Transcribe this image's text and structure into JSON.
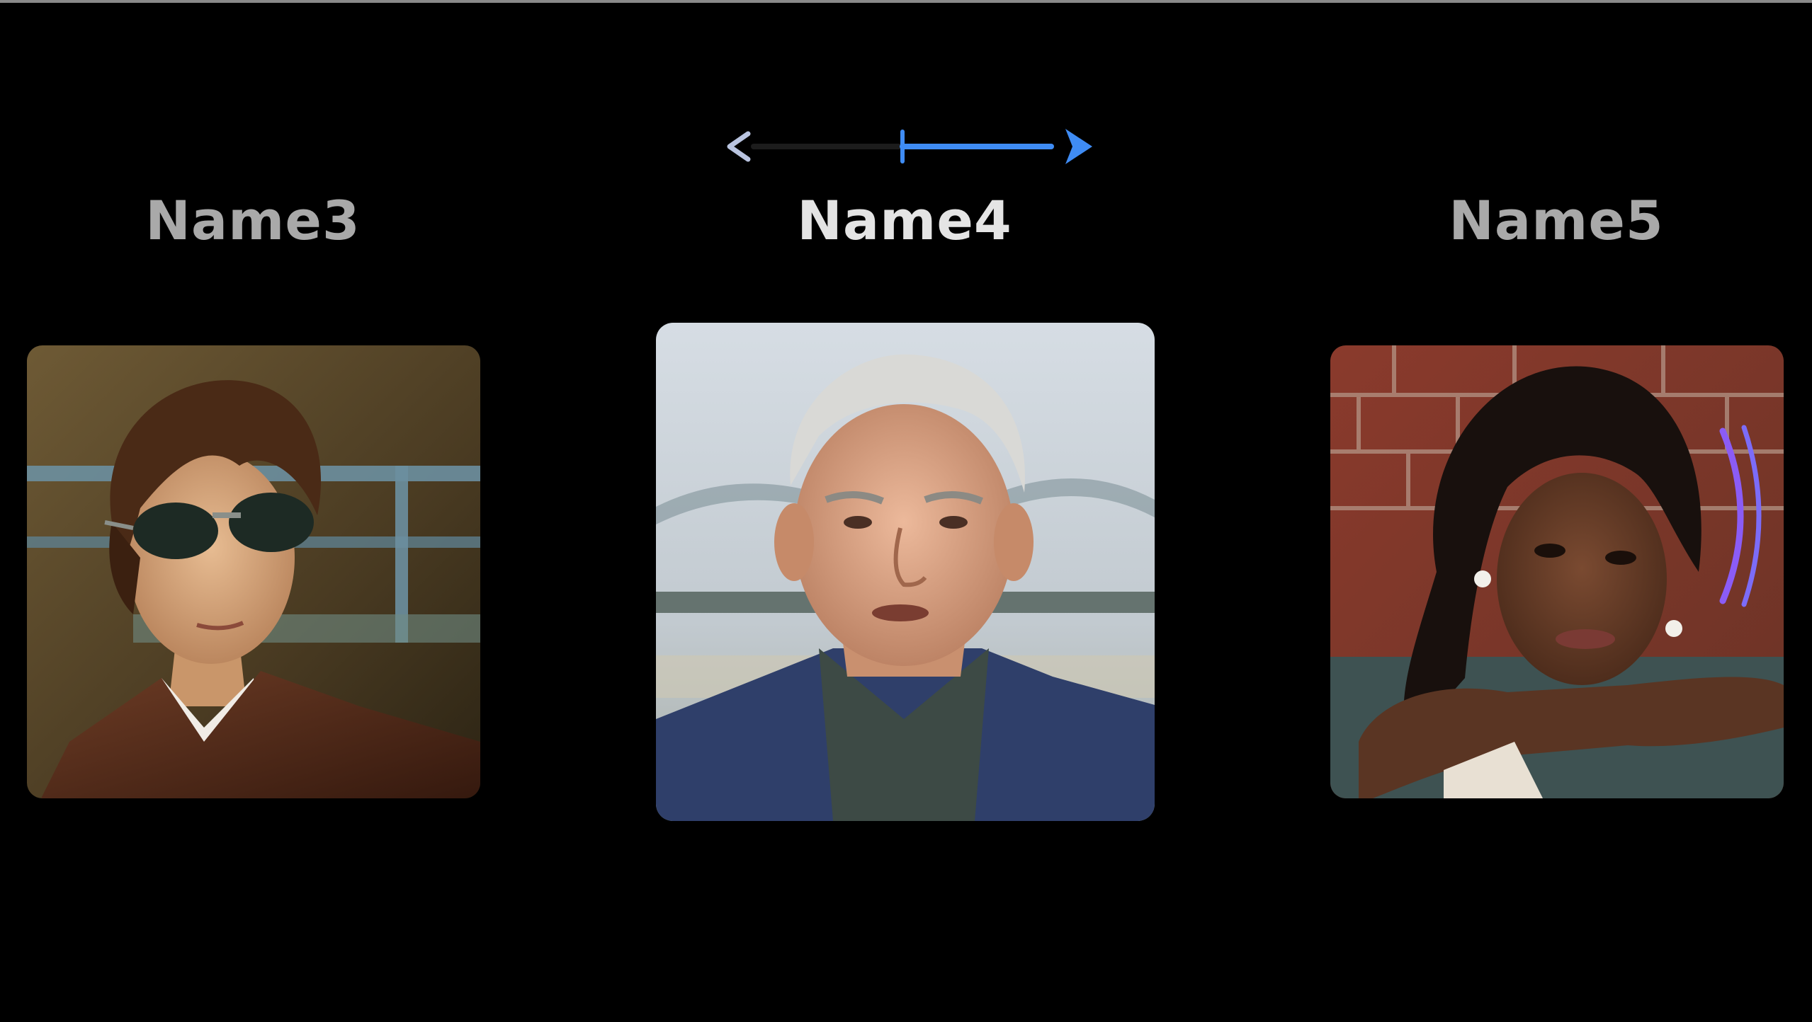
{
  "carousel": {
    "profiles": [
      {
        "name": "Name3",
        "state": "inactive"
      },
      {
        "name": "Name4",
        "state": "selected"
      },
      {
        "name": "Name5",
        "state": "inactive"
      }
    ],
    "scrubber": {
      "prev_icon": "chevron-left-icon",
      "next_icon": "chevron-right-icon",
      "progress": 0.5
    },
    "speaking_indicator_icon": "audio-waves-icon"
  },
  "colors": {
    "background": "#000000",
    "accent": "#3f8cf4",
    "track": "#1c1c1c",
    "label_active": "#e4e4e4",
    "label_inactive": "#a9a9a9",
    "speaking": "#8b5cf6"
  }
}
